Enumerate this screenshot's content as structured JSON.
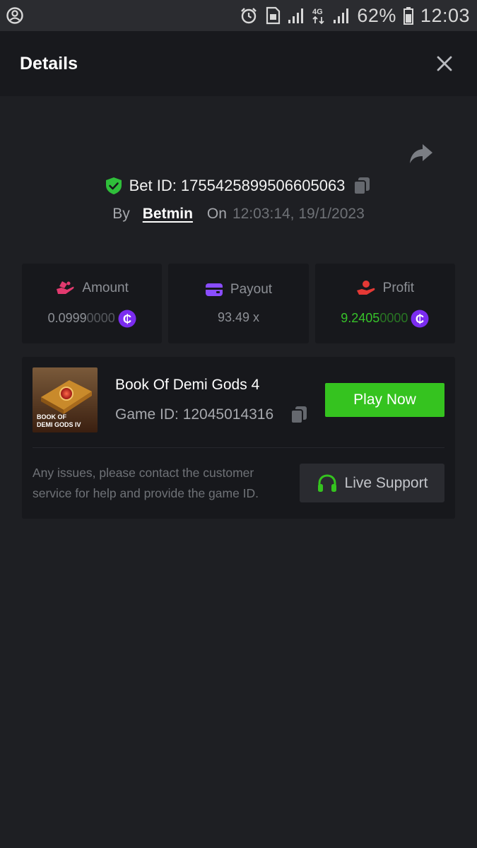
{
  "status_bar": {
    "battery_percent": "62%",
    "time": "12:03"
  },
  "header": {
    "title": "Details"
  },
  "bet": {
    "bet_id_label": "Bet ID: 1755425899506605063",
    "by_label": "By",
    "user": "Betmin",
    "on_label": "On",
    "timestamp": "12:03:14, 19/1/2023"
  },
  "stats": {
    "amount": {
      "label": "Amount",
      "value_main": "0.0999",
      "value_dim": "0000",
      "icon": "hand-coins-icon",
      "icon_color": "#e23a6f"
    },
    "payout": {
      "label": "Payout",
      "value": "93.49 x",
      "icon": "wallet-icon",
      "icon_color": "#8a4dff"
    },
    "profit": {
      "label": "Profit",
      "value_main": "9.2405",
      "value_dim": "0000",
      "icon": "hand-profit-icon",
      "icon_color": "#e53935"
    },
    "coin_color": "#7b2cf0"
  },
  "game": {
    "thumb_caption_line1": "BOOK OF",
    "thumb_caption_line2": "DEMI GODS IV",
    "name": "Book Of Demi Gods 4",
    "game_id_label": "Game ID: 12045014316",
    "play_label": "Play Now",
    "issue_text": "Any issues, please contact the customer service for help and provide the game ID.",
    "support_label": "Live Support"
  },
  "colors": {
    "accent_green": "#35c31f",
    "background": "#1e1f23",
    "card": "#17181c"
  }
}
